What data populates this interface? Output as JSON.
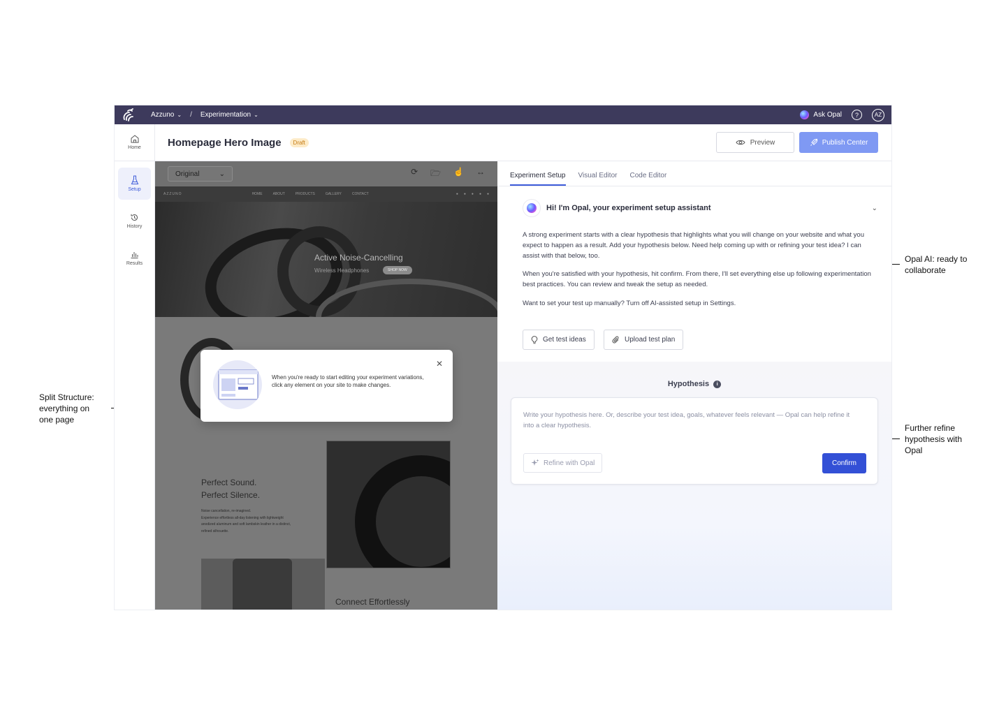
{
  "annotations": {
    "left": [
      "Split Structure:",
      "everything on",
      "one page"
    ],
    "right_top": [
      "Opal AI: ready to",
      "collaborate"
    ],
    "right_bottom": [
      "Further refine",
      "hypothesis with",
      "Opal"
    ]
  },
  "topbar": {
    "workspace": "Azzuno",
    "separator": "/",
    "section": "Experimentation",
    "ask_opal": "Ask Opal",
    "help_icon": "?",
    "avatar": "AZ"
  },
  "sidebar": {
    "items": [
      {
        "label": "Home",
        "icon": "home-icon"
      },
      {
        "label": "Setup",
        "icon": "flask-icon"
      },
      {
        "label": "History",
        "icon": "history-icon"
      },
      {
        "label": "Results",
        "icon": "chart-icon"
      }
    ]
  },
  "header": {
    "title": "Homepage Hero Image",
    "status": "Draft",
    "preview_label": "Preview",
    "publish_label": "Publish Center"
  },
  "preview": {
    "variation": "Original",
    "site": {
      "brand": "AZZUNO",
      "nav_links": [
        "HOME",
        "ABOUT",
        "PRODUCTS",
        "GALLERY",
        "CONTACT"
      ],
      "hero_title": "Active Noise-Cancelling",
      "hero_subtitle": "Wireless Headphones",
      "hero_cta": "SHOP NOW",
      "section_title_1": "Perfect Sound.",
      "section_title_2": "Perfect Silence.",
      "section_body": [
        "Noise cancellation, re-imagined.",
        "Experience effortless all-day listening with lightweight",
        "anodized aluminum and soft lambskin leather in a distinct,",
        "refined silhouette."
      ],
      "section_title_3": "Connect Effortlessly"
    },
    "tooltip": {
      "text": "When you're ready to start editing your experiment variations, click any element on your site to make changes."
    }
  },
  "panel": {
    "tabs": [
      "Experiment Setup",
      "Visual Editor",
      "Code Editor"
    ],
    "opal_title": "Hi! I'm Opal, your experiment setup assistant",
    "paragraphs": [
      "A strong experiment starts with a clear hypothesis that highlights what you will change on your website and what you expect to happen as a result. Add your hypothesis below. Need help coming up with or refining your test idea? I can assist with that below, too.",
      "When you're satisfied with your hypothesis, hit confirm. From there, I'll set everything else up following experimentation best practices. You can review and tweak the setup as needed.",
      "Want to set your test up manually? Turn off AI-assisted setup in Settings."
    ],
    "get_ideas_label": "Get test ideas",
    "upload_label": "Upload test plan",
    "hypothesis_title": "Hypothesis",
    "hypothesis_placeholder": "Write your hypothesis here. Or, describe your test idea, goals, whatever feels relevant — Opal can help refine it into a clear hypothesis.",
    "refine_label": "Refine with Opal",
    "confirm_label": "Confirm"
  },
  "colors": {
    "topbar": "#3d3a5c",
    "accent": "#3350d6",
    "publish": "#7f99f3",
    "draft_badge": "#fdebc8"
  }
}
